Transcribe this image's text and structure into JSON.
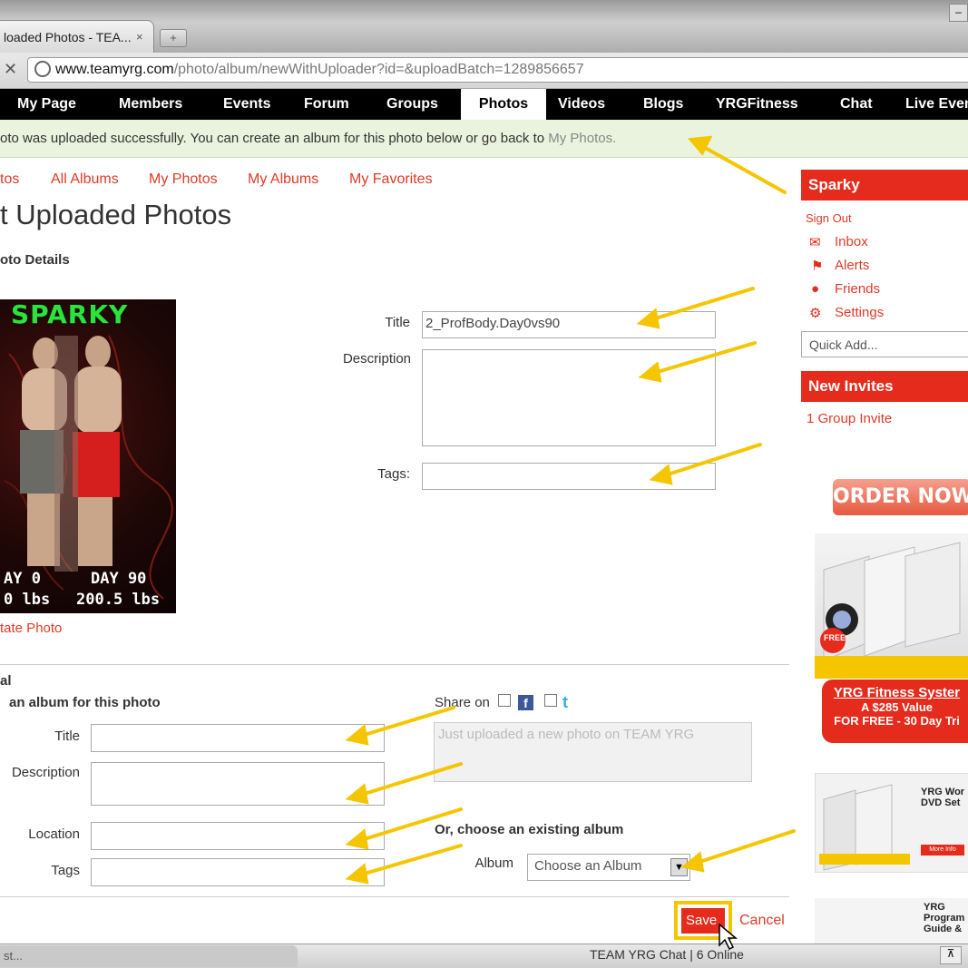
{
  "browser": {
    "tab_title": "loaded Photos - TEA...",
    "tab_close": "×",
    "new_tab": "+",
    "url_host": "www.teamyrg.com",
    "url_path": "/photo/album/newWithUploader?id=&uploadBatch=1289856657"
  },
  "nav": {
    "items": [
      "My Page",
      "Members",
      "Events",
      "Forum",
      "Groups",
      "Photos",
      "Videos",
      "Blogs",
      "YRGFitness",
      "Chat",
      "Live Even"
    ],
    "active": "Photos"
  },
  "notice": {
    "text": "oto was uploaded successfully. You can create an album for this photo below or go back to ",
    "link": "My Photos."
  },
  "subnav": [
    "tos",
    "All Albums",
    "My Photos",
    "My Albums",
    "My Favorites"
  ],
  "page_title": "t Uploaded Photos",
  "section_title": "oto Details",
  "photo": {
    "title": "SPARKY",
    "cap_left": "AY 0",
    "cap_right": "DAY 90",
    "weight_left": "0 lbs",
    "weight_right": "200.5 lbs",
    "rotate_link": "tate Photo"
  },
  "details_form": {
    "title_label": "Title",
    "title_value": "2_ProfBody.Day0vs90",
    "description_label": "Description",
    "tags_label": "Tags:"
  },
  "album_form": {
    "section_label": "al",
    "create_label": "an album for this photo",
    "title_label": "Title",
    "description_label": "Description",
    "location_label": "Location",
    "tags_label": "Tags",
    "share_label": "Share on",
    "share_placeholder": "Just uploaded a new photo on TEAM YRG",
    "existing_label": "Or, choose an existing album",
    "album_label": "Album",
    "album_select": "Choose an Album"
  },
  "actions": {
    "save": "Save",
    "cancel": "Cancel"
  },
  "sidebar": {
    "user": "Sparky",
    "sign_out": "Sign Out",
    "links": [
      {
        "label": "Inbox",
        "icon": "envelope-icon"
      },
      {
        "label": "Alerts",
        "icon": "bell-icon"
      },
      {
        "label": "Friends",
        "icon": "person-icon"
      },
      {
        "label": "Settings",
        "icon": "gear-icon"
      }
    ],
    "quick_add": "Quick Add...",
    "invites_header": "New Invites",
    "invite_link": "1 Group Invite",
    "order_now": "ORDER NOW!",
    "promo_title": "YRG Fitness Syster",
    "promo_value": "A $285 Value",
    "promo_free": "FOR FREE - 30 Day Tri",
    "free_badge": "FREE",
    "dvd_title": "YRG Wor DVD Set",
    "more_info": "More Info",
    "guide_title": "YRG Program Guide &"
  },
  "status_bar": {
    "left": "st...",
    "chat": "TEAM YRG Chat | 6 Online"
  },
  "colors": {
    "brand_red": "#e52b1b",
    "link_red": "#e03a26",
    "annotation_arrow": "#f5c500",
    "notice_bg": "#eaf3dd"
  }
}
